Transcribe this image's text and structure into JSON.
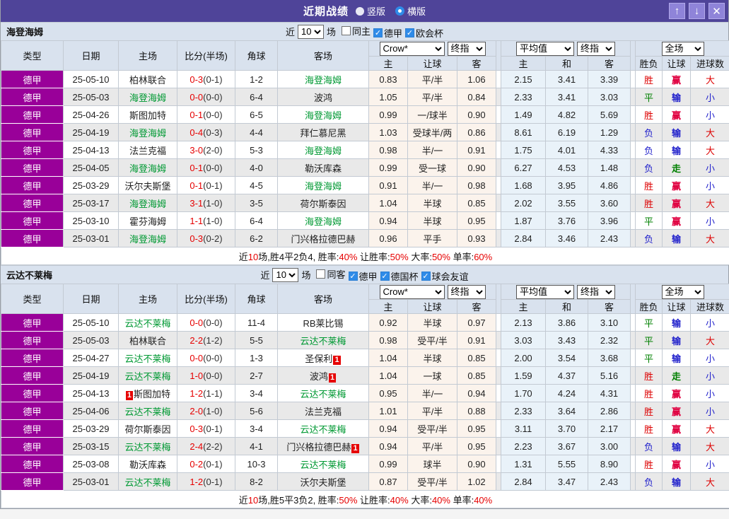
{
  "colors": {
    "titlebar_purple": "#4f4499",
    "league_magenta": "#990099",
    "team_green": "#009933",
    "score_red": "#e60000",
    "header_bg": "#d9e2ee",
    "odds_bg": "#fbf3ec",
    "avg_bg": "#e9f2f9",
    "flag_colors": {
      "胜": "#dd0000",
      "平": "#008000",
      "负": "#2222cc",
      "赢": "#e00040",
      "输": "#2222cc",
      "走": "#008000",
      "大": "#dd0000",
      "小": "#2222cc"
    }
  },
  "icons": {
    "up": "↑",
    "down": "↓",
    "close": "✕",
    "check": "✓"
  },
  "titlebar": {
    "title": "近期战绩",
    "radios": [
      {
        "label": "竖版",
        "selected": false
      },
      {
        "label": "横版",
        "selected": true
      }
    ]
  },
  "filter_labels": {
    "near": "近",
    "matches": "场"
  },
  "table_headers": {
    "type": "类型",
    "date": "日期",
    "home": "主场",
    "score": "比分(半场)",
    "corner": "角球",
    "away": "客场",
    "group1_select1": "Crow*",
    "group1_select2": "终指",
    "group2_select1": "平均值",
    "group2_select2": "终指",
    "group3_select1": "全场",
    "odds_home": "主",
    "odds_handicap": "让球",
    "odds_away": "客",
    "avg_home": "主",
    "avg_draw": "和",
    "avg_away": "客",
    "result": "胜负",
    "handicap_result": "让球",
    "goals": "进球数"
  },
  "sections": [
    {
      "team": "海登海姆",
      "filter": {
        "count": "10",
        "checkboxes": [
          {
            "label": "同主",
            "checked": false
          },
          {
            "label": "德甲",
            "checked": true
          },
          {
            "label": "欧会杯",
            "checked": true
          }
        ]
      },
      "rows": [
        {
          "league": "德甲",
          "date": "25-05-10",
          "home": {
            "name": "柏林联合",
            "is_team": false
          },
          "score": {
            "ft": "0-3",
            "ht": "(0-1)"
          },
          "corner": "1-2",
          "away": {
            "name": "海登海姆",
            "is_team": true
          },
          "odds": [
            "0.83",
            "平/半",
            "1.06"
          ],
          "avg": [
            "2.15",
            "3.41",
            "3.39"
          ],
          "result": "胜",
          "handicap": "赢",
          "goals": "大"
        },
        {
          "league": "德甲",
          "date": "25-05-03",
          "home": {
            "name": "海登海姆",
            "is_team": true
          },
          "score": {
            "ft": "0-0",
            "ht": "(0-0)"
          },
          "corner": "6-4",
          "away": {
            "name": "波鸿",
            "is_team": false
          },
          "odds": [
            "1.05",
            "平/半",
            "0.84"
          ],
          "avg": [
            "2.33",
            "3.41",
            "3.03"
          ],
          "result": "平",
          "handicap": "输",
          "goals": "小"
        },
        {
          "league": "德甲",
          "date": "25-04-26",
          "home": {
            "name": "斯图加特",
            "is_team": false
          },
          "score": {
            "ft": "0-1",
            "ht": "(0-0)"
          },
          "corner": "6-5",
          "away": {
            "name": "海登海姆",
            "is_team": true
          },
          "odds": [
            "0.99",
            "一/球半",
            "0.90"
          ],
          "avg": [
            "1.49",
            "4.82",
            "5.69"
          ],
          "result": "胜",
          "handicap": "赢",
          "goals": "小"
        },
        {
          "league": "德甲",
          "date": "25-04-19",
          "home": {
            "name": "海登海姆",
            "is_team": true
          },
          "score": {
            "ft": "0-4",
            "ht": "(0-3)"
          },
          "corner": "4-4",
          "away": {
            "name": "拜仁慕尼黑",
            "is_team": false
          },
          "odds": [
            "1.03",
            "受球半/两",
            "0.86"
          ],
          "avg": [
            "8.61",
            "6.19",
            "1.29"
          ],
          "result": "负",
          "handicap": "输",
          "goals": "大"
        },
        {
          "league": "德甲",
          "date": "25-04-13",
          "home": {
            "name": "法兰克福",
            "is_team": false
          },
          "score": {
            "ft": "3-0",
            "ht": "(2-0)"
          },
          "corner": "5-3",
          "away": {
            "name": "海登海姆",
            "is_team": true
          },
          "odds": [
            "0.98",
            "半/一",
            "0.91"
          ],
          "avg": [
            "1.75",
            "4.01",
            "4.33"
          ],
          "result": "负",
          "handicap": "输",
          "goals": "大"
        },
        {
          "league": "德甲",
          "date": "25-04-05",
          "home": {
            "name": "海登海姆",
            "is_team": true
          },
          "score": {
            "ft": "0-1",
            "ht": "(0-0)"
          },
          "corner": "4-0",
          "away": {
            "name": "勒沃库森",
            "is_team": false
          },
          "odds": [
            "0.99",
            "受一球",
            "0.90"
          ],
          "avg": [
            "6.27",
            "4.53",
            "1.48"
          ],
          "result": "负",
          "handicap": "走",
          "goals": "小"
        },
        {
          "league": "德甲",
          "date": "25-03-29",
          "home": {
            "name": "沃尔夫斯堡",
            "is_team": false
          },
          "score": {
            "ft": "0-1",
            "ht": "(0-1)"
          },
          "corner": "4-5",
          "away": {
            "name": "海登海姆",
            "is_team": true
          },
          "odds": [
            "0.91",
            "半/一",
            "0.98"
          ],
          "avg": [
            "1.68",
            "3.95",
            "4.86"
          ],
          "result": "胜",
          "handicap": "赢",
          "goals": "小"
        },
        {
          "league": "德甲",
          "date": "25-03-17",
          "home": {
            "name": "海登海姆",
            "is_team": true
          },
          "score": {
            "ft": "3-1",
            "ht": "(1-0)"
          },
          "corner": "3-5",
          "away": {
            "name": "荷尔斯泰因",
            "is_team": false
          },
          "odds": [
            "1.04",
            "半球",
            "0.85"
          ],
          "avg": [
            "2.02",
            "3.55",
            "3.60"
          ],
          "result": "胜",
          "handicap": "赢",
          "goals": "大"
        },
        {
          "league": "德甲",
          "date": "25-03-10",
          "home": {
            "name": "霍芬海姆",
            "is_team": false
          },
          "score": {
            "ft": "1-1",
            "ht": "(1-0)"
          },
          "corner": "6-4",
          "away": {
            "name": "海登海姆",
            "is_team": true
          },
          "odds": [
            "0.94",
            "半球",
            "0.95"
          ],
          "avg": [
            "1.87",
            "3.76",
            "3.96"
          ],
          "result": "平",
          "handicap": "赢",
          "goals": "小"
        },
        {
          "league": "德甲",
          "date": "25-03-01",
          "home": {
            "name": "海登海姆",
            "is_team": true
          },
          "score": {
            "ft": "0-3",
            "ht": "(0-2)"
          },
          "corner": "6-2",
          "away": {
            "name": "门兴格拉德巴赫",
            "is_team": false
          },
          "odds": [
            "0.96",
            "平手",
            "0.93"
          ],
          "avg": [
            "2.84",
            "3.46",
            "2.43"
          ],
          "result": "负",
          "handicap": "输",
          "goals": "大"
        }
      ],
      "summary": [
        {
          "t": "近"
        },
        {
          "t": "10",
          "red": true
        },
        {
          "t": "场,胜4平2负4, 胜率:"
        },
        {
          "t": "40%",
          "red": true
        },
        {
          "t": " 让胜率:"
        },
        {
          "t": "50%",
          "red": true
        },
        {
          "t": " 大率:"
        },
        {
          "t": "50%",
          "red": true
        },
        {
          "t": " 单率:"
        },
        {
          "t": "60%",
          "red": true
        }
      ]
    },
    {
      "team": "云达不莱梅",
      "filter": {
        "count": "10",
        "checkboxes": [
          {
            "label": "同客",
            "checked": false
          },
          {
            "label": "德甲",
            "checked": true
          },
          {
            "label": "德国杯",
            "checked": true
          },
          {
            "label": "球会友谊",
            "checked": true
          }
        ]
      },
      "rows": [
        {
          "league": "德甲",
          "date": "25-05-10",
          "home": {
            "name": "云达不莱梅",
            "is_team": true
          },
          "score": {
            "ft": "0-0",
            "ht": "(0-0)"
          },
          "corner": "11-4",
          "away": {
            "name": "RB莱比锡",
            "is_team": false
          },
          "odds": [
            "0.92",
            "半球",
            "0.97"
          ],
          "avg": [
            "2.13",
            "3.86",
            "3.10"
          ],
          "result": "平",
          "handicap": "输",
          "goals": "小"
        },
        {
          "league": "德甲",
          "date": "25-05-03",
          "home": {
            "name": "柏林联合",
            "is_team": false
          },
          "score": {
            "ft": "2-2",
            "ht": "(1-2)"
          },
          "corner": "5-5",
          "away": {
            "name": "云达不莱梅",
            "is_team": true
          },
          "odds": [
            "0.98",
            "受平/半",
            "0.91"
          ],
          "avg": [
            "3.03",
            "3.43",
            "2.32"
          ],
          "result": "平",
          "handicap": "输",
          "goals": "大"
        },
        {
          "league": "德甲",
          "date": "25-04-27",
          "home": {
            "name": "云达不莱梅",
            "is_team": true
          },
          "score": {
            "ft": "0-0",
            "ht": "(0-0)"
          },
          "corner": "1-3",
          "away": {
            "name": "圣保利",
            "is_team": false,
            "badge_after": "1"
          },
          "odds": [
            "1.04",
            "半球",
            "0.85"
          ],
          "avg": [
            "2.00",
            "3.54",
            "3.68"
          ],
          "result": "平",
          "handicap": "输",
          "goals": "小"
        },
        {
          "league": "德甲",
          "date": "25-04-19",
          "home": {
            "name": "云达不莱梅",
            "is_team": true
          },
          "score": {
            "ft": "1-0",
            "ht": "(0-0)"
          },
          "corner": "2-7",
          "away": {
            "name": "波鸿",
            "is_team": false,
            "badge_after": "1"
          },
          "odds": [
            "1.04",
            "一球",
            "0.85"
          ],
          "avg": [
            "1.59",
            "4.37",
            "5.16"
          ],
          "result": "胜",
          "handicap": "走",
          "goals": "小"
        },
        {
          "league": "德甲",
          "date": "25-04-13",
          "home": {
            "name": "斯图加特",
            "is_team": false,
            "badge_before": "1"
          },
          "score": {
            "ft": "1-2",
            "ht": "(1-1)"
          },
          "corner": "3-4",
          "away": {
            "name": "云达不莱梅",
            "is_team": true
          },
          "odds": [
            "0.95",
            "半/一",
            "0.94"
          ],
          "avg": [
            "1.70",
            "4.24",
            "4.31"
          ],
          "result": "胜",
          "handicap": "赢",
          "goals": "小"
        },
        {
          "league": "德甲",
          "date": "25-04-06",
          "home": {
            "name": "云达不莱梅",
            "is_team": true
          },
          "score": {
            "ft": "2-0",
            "ht": "(1-0)"
          },
          "corner": "5-6",
          "away": {
            "name": "法兰克福",
            "is_team": false
          },
          "odds": [
            "1.01",
            "平/半",
            "0.88"
          ],
          "avg": [
            "2.33",
            "3.64",
            "2.86"
          ],
          "result": "胜",
          "handicap": "赢",
          "goals": "小"
        },
        {
          "league": "德甲",
          "date": "25-03-29",
          "home": {
            "name": "荷尔斯泰因",
            "is_team": false
          },
          "score": {
            "ft": "0-3",
            "ht": "(0-1)"
          },
          "corner": "3-4",
          "away": {
            "name": "云达不莱梅",
            "is_team": true
          },
          "odds": [
            "0.94",
            "受平/半",
            "0.95"
          ],
          "avg": [
            "3.11",
            "3.70",
            "2.17"
          ],
          "result": "胜",
          "handicap": "赢",
          "goals": "大"
        },
        {
          "league": "德甲",
          "date": "25-03-15",
          "home": {
            "name": "云达不莱梅",
            "is_team": true
          },
          "score": {
            "ft": "2-4",
            "ht": "(2-2)"
          },
          "corner": "4-1",
          "away": {
            "name": "门兴格拉德巴赫",
            "is_team": false,
            "badge_after": "1"
          },
          "odds": [
            "0.94",
            "平/半",
            "0.95"
          ],
          "avg": [
            "2.23",
            "3.67",
            "3.00"
          ],
          "result": "负",
          "handicap": "输",
          "goals": "大"
        },
        {
          "league": "德甲",
          "date": "25-03-08",
          "home": {
            "name": "勒沃库森",
            "is_team": false
          },
          "score": {
            "ft": "0-2",
            "ht": "(0-1)"
          },
          "corner": "10-3",
          "away": {
            "name": "云达不莱梅",
            "is_team": true
          },
          "odds": [
            "0.99",
            "球半",
            "0.90"
          ],
          "avg": [
            "1.31",
            "5.55",
            "8.90"
          ],
          "result": "胜",
          "handicap": "赢",
          "goals": "小"
        },
        {
          "league": "德甲",
          "date": "25-03-01",
          "home": {
            "name": "云达不莱梅",
            "is_team": true
          },
          "score": {
            "ft": "1-2",
            "ht": "(0-1)"
          },
          "corner": "8-2",
          "away": {
            "name": "沃尔夫斯堡",
            "is_team": false
          },
          "odds": [
            "0.87",
            "受平/半",
            "1.02"
          ],
          "avg": [
            "2.84",
            "3.47",
            "2.43"
          ],
          "result": "负",
          "handicap": "输",
          "goals": "大"
        }
      ],
      "summary": [
        {
          "t": "近"
        },
        {
          "t": "10",
          "red": true
        },
        {
          "t": "场,胜5平3负2, 胜率:"
        },
        {
          "t": "50%",
          "red": true
        },
        {
          "t": " 让胜率:"
        },
        {
          "t": "40%",
          "red": true
        },
        {
          "t": " 大率:"
        },
        {
          "t": "40%",
          "red": true
        },
        {
          "t": " 单率:"
        },
        {
          "t": "40%",
          "red": true
        }
      ]
    }
  ]
}
